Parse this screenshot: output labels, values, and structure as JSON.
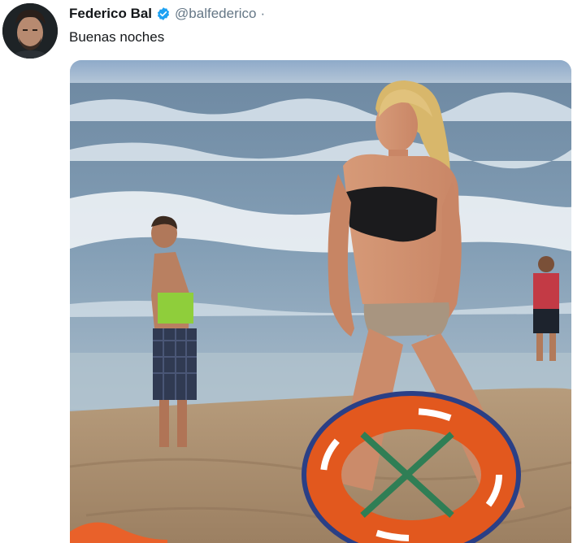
{
  "tweet": {
    "author_name": "Federico Bal",
    "handle": "@balfederico",
    "separator": "·",
    "text": "Buenas noches",
    "verified_color": "#1da1f2"
  },
  "icons": {
    "verified": "verified-badge-icon"
  },
  "media": {
    "description_kind": "photo"
  }
}
